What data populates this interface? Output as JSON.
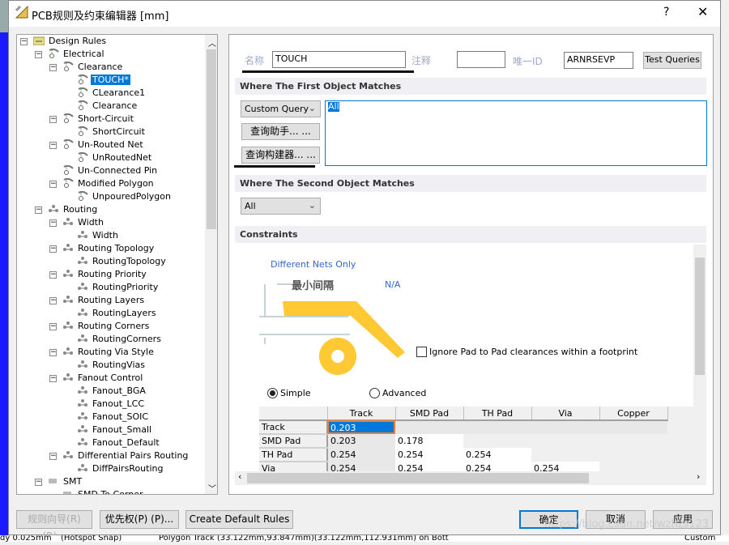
{
  "window": {
    "title": "PCB规则及约束编辑器 [mm]",
    "help": "?",
    "close": "✕"
  },
  "tree": [
    {
      "label": "Design Rules",
      "level": 0,
      "expand": "−",
      "icon": "folder-icon"
    },
    {
      "label": "Electrical",
      "level": 1,
      "expand": "−",
      "icon": "rule-category-icon"
    },
    {
      "label": "Clearance",
      "level": 2,
      "expand": "−",
      "icon": "rule-type-icon"
    },
    {
      "label": "TOUCH*",
      "level": 3,
      "icon": "rule-icon",
      "selected": true
    },
    {
      "label": "CLearance1",
      "level": 3,
      "icon": "rule-icon"
    },
    {
      "label": "Clearance",
      "level": 3,
      "icon": "rule-icon"
    },
    {
      "label": "Short-Circuit",
      "level": 2,
      "expand": "−",
      "icon": "rule-type-icon"
    },
    {
      "label": "ShortCircuit",
      "level": 3,
      "icon": "rule-icon"
    },
    {
      "label": "Un-Routed Net",
      "level": 2,
      "expand": "−",
      "icon": "rule-type-icon"
    },
    {
      "label": "UnRoutedNet",
      "level": 3,
      "icon": "rule-icon"
    },
    {
      "label": "Un-Connected Pin",
      "level": 2,
      "icon": "rule-type-icon"
    },
    {
      "label": "Modified Polygon",
      "level": 2,
      "expand": "−",
      "icon": "rule-type-icon"
    },
    {
      "label": "UnpouredPolygon",
      "level": 3,
      "icon": "rule-icon"
    },
    {
      "label": "Routing",
      "level": 1,
      "expand": "−",
      "icon": "routing-icon"
    },
    {
      "label": "Width",
      "level": 2,
      "expand": "−",
      "icon": "routing-icon"
    },
    {
      "label": "Width",
      "level": 3,
      "icon": "routing-icon"
    },
    {
      "label": "Routing Topology",
      "level": 2,
      "expand": "−",
      "icon": "routing-icon"
    },
    {
      "label": "RoutingTopology",
      "level": 3,
      "icon": "routing-icon"
    },
    {
      "label": "Routing Priority",
      "level": 2,
      "expand": "−",
      "icon": "routing-icon"
    },
    {
      "label": "RoutingPriority",
      "level": 3,
      "icon": "routing-icon"
    },
    {
      "label": "Routing Layers",
      "level": 2,
      "expand": "−",
      "icon": "routing-icon"
    },
    {
      "label": "RoutingLayers",
      "level": 3,
      "icon": "routing-icon"
    },
    {
      "label": "Routing Corners",
      "level": 2,
      "expand": "−",
      "icon": "routing-icon"
    },
    {
      "label": "RoutingCorners",
      "level": 3,
      "icon": "routing-icon"
    },
    {
      "label": "Routing Via Style",
      "level": 2,
      "expand": "−",
      "icon": "routing-icon"
    },
    {
      "label": "RoutingVias",
      "level": 3,
      "icon": "routing-icon"
    },
    {
      "label": "Fanout Control",
      "level": 2,
      "expand": "−",
      "icon": "routing-icon"
    },
    {
      "label": "Fanout_BGA",
      "level": 3,
      "icon": "routing-icon"
    },
    {
      "label": "Fanout_LCC",
      "level": 3,
      "icon": "routing-icon"
    },
    {
      "label": "Fanout_SOIC",
      "level": 3,
      "icon": "routing-icon"
    },
    {
      "label": "Fanout_Small",
      "level": 3,
      "icon": "routing-icon"
    },
    {
      "label": "Fanout_Default",
      "level": 3,
      "icon": "routing-icon"
    },
    {
      "label": "Differential Pairs Routing",
      "level": 2,
      "expand": "−",
      "icon": "routing-icon"
    },
    {
      "label": "DiffPairsRouting",
      "level": 3,
      "icon": "routing-icon"
    },
    {
      "label": "SMT",
      "level": 1,
      "expand": "−",
      "icon": "smt-icon"
    },
    {
      "label": "SMD To Corner",
      "level": 2,
      "icon": "smt-icon"
    }
  ],
  "rule": {
    "name_label": "名称",
    "name_value": "TOUCH",
    "comment_label": "注释",
    "comment_value": "",
    "uid_label": "唯一ID",
    "uid_value": "ARNRSEVP",
    "test_queries": "Test Queries"
  },
  "first": {
    "header": "Where The First Object Matches",
    "combo": "Custom Query",
    "helper": "查询助手... ...",
    "builder": "查询构建器... ...",
    "query": "All"
  },
  "second": {
    "header": "Where The Second Object Matches",
    "combo": "All"
  },
  "constraints": {
    "header": "Constraints",
    "net_scope": "Different Nets Only",
    "min_clearance": "最小间隔",
    "min_value": "N/A",
    "ignore_pad": "Ignore Pad to Pad clearances within a footprint",
    "ignore_pad_checked": false,
    "simple": "Simple",
    "advanced": "Advanced",
    "mode": "simple",
    "columns": [
      "Track",
      "SMD Pad",
      "TH Pad",
      "Via",
      "Copper"
    ],
    "rows": [
      {
        "name": "Track",
        "values": [
          "0.203"
        ]
      },
      {
        "name": "SMD Pad",
        "values": [
          "0.203",
          "0.178"
        ]
      },
      {
        "name": "TH Pad",
        "values": [
          "0.254",
          "0.254",
          "0.254"
        ]
      },
      {
        "name": "Via",
        "values": [
          "0.254",
          "0.254",
          "0.254",
          "0.254"
        ]
      }
    ]
  },
  "buttons": {
    "wizard": "规则向导(R) (R)...",
    "priority": "优先权(P) (P)...",
    "defaults": "Create Default Rules",
    "ok": "确定",
    "cancel": "取消",
    "apply": "应用"
  },
  "watermark": "https://blog.csdn.net/wzhzs123",
  "status": {
    "left": "dy 0.025mm",
    "snap": "(Hotspot Snap)",
    "info": "Polygon Track (33.122mm,93.847mm)(33.122mm,112.931mm) on Bott",
    "right": "Custom"
  },
  "colors": {
    "accent": "#0078d7",
    "pad": "#ffc933",
    "link": "#3366cc"
  }
}
